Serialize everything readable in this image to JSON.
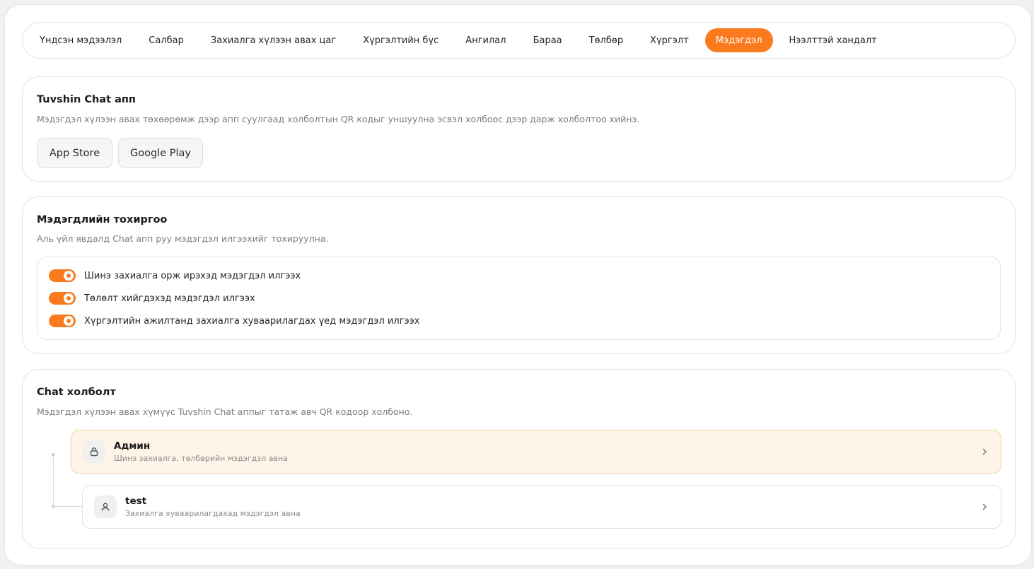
{
  "tabs": [
    {
      "label": "Үндсэн мэдээлэл",
      "active": false
    },
    {
      "label": "Салбар",
      "active": false
    },
    {
      "label": "Захиалга хүлээн авах цаг",
      "active": false
    },
    {
      "label": "Хүргэлтийн бүс",
      "active": false
    },
    {
      "label": "Ангилал",
      "active": false
    },
    {
      "label": "Бараа",
      "active": false
    },
    {
      "label": "Төлбөр",
      "active": false
    },
    {
      "label": "Хүргэлт",
      "active": false
    },
    {
      "label": "Мэдэгдэл",
      "active": true
    },
    {
      "label": "Нээлттэй хандалт",
      "active": false
    }
  ],
  "app_card": {
    "title": "Tuvshin Chat апп",
    "description": "Мэдэгдэл хүлээн авах төхөөрөмж дээр апп суулгаад холболтын QR кодыг уншуулна эсвэл холбоос дээр дарж холболтоо хийнэ.",
    "app_store_label": "App Store",
    "google_play_label": "Google Play"
  },
  "settings_card": {
    "title": "Мэдэгдлийн тохиргоо",
    "description": "Аль үйл явдалд Chat апп руу мэдэгдэл илгээхийг тохируулна.",
    "toggles": [
      {
        "label": "Шинэ захиалга орж ирэхэд мэдэгдэл илгээх",
        "enabled": true
      },
      {
        "label": "Төлөлт хийгдэхэд мэдэгдэл илгээх",
        "enabled": true
      },
      {
        "label": "Хүргэлтийн ажилтанд захиалга хуваарилагдах үед мэдэгдэл илгээх",
        "enabled": true
      }
    ]
  },
  "chat_card": {
    "title": "Chat холболт",
    "description": "Мэдэгдэл хүлээн авах хүмүүс Tuvshin Chat аппыг татаж авч QR кодоор холбоно.",
    "members": [
      {
        "name": "Админ",
        "subtitle": "Шинэ захиалга, төлбөрийн мэдэгдэл авна",
        "icon": "lock-icon"
      },
      {
        "name": "test",
        "subtitle": "Захиалга хуваарилагдахад мэдэгдэл авна",
        "icon": "user-icon"
      }
    ]
  },
  "colors": {
    "accent": "#fb7a1e",
    "admin_bg": "#fff4e8",
    "admin_border": "#f7cf9f"
  }
}
